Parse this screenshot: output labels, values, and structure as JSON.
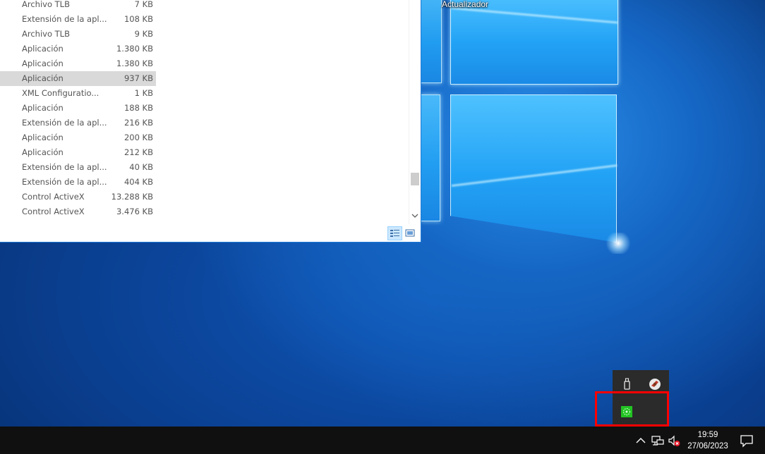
{
  "desktop": {
    "shortcut_label": "Actualizador",
    "wallpaper": "windows-10-hero"
  },
  "explorer": {
    "files": [
      {
        "type": "Archivo TLB",
        "size": "7 KB"
      },
      {
        "type": "Extensión de la apl...",
        "size": "108 KB"
      },
      {
        "type": "Archivo TLB",
        "size": "9 KB"
      },
      {
        "type": "Aplicación",
        "size": "1.380 KB"
      },
      {
        "type": "Aplicación",
        "size": "1.380 KB"
      },
      {
        "type": "Aplicación",
        "size": "937 KB",
        "selected": true
      },
      {
        "type": "XML Configuratio...",
        "size": "1 KB"
      },
      {
        "type": "Aplicación",
        "size": "188 KB"
      },
      {
        "type": "Extensión de la apl...",
        "size": "216 KB"
      },
      {
        "type": "Aplicación",
        "size": "200 KB"
      },
      {
        "type": "Aplicación",
        "size": "212 KB"
      },
      {
        "type": "Extensión de la apl...",
        "size": "40 KB"
      },
      {
        "type": "Extensión de la apl...",
        "size": "404 KB"
      },
      {
        "type": "Control ActiveX",
        "size": "13.288 KB"
      },
      {
        "type": "Control ActiveX",
        "size": "3.476 KB"
      }
    ],
    "view_buttons": [
      {
        "name": "details-view-icon",
        "active": true
      },
      {
        "name": "large-icons-view-icon",
        "active": false
      }
    ]
  },
  "tray_overflow": {
    "icons": [
      "usb-device-icon",
      "browser-update-icon",
      "green-app-icon"
    ],
    "highlighted": "green-app-icon",
    "highlight_color": "#ff0000"
  },
  "taskbar": {
    "time": "19:59",
    "date": "27/06/2023",
    "tray_icons": [
      "show-hidden-icons-chevron",
      "network-icon",
      "volume-muted-icon",
      "action-center-icon"
    ]
  },
  "colors": {
    "selected_row": "#d9d9d9",
    "taskbar": "#101010",
    "overflow_bg": "#2b2b2b",
    "window_border": "#1f7ad6"
  }
}
